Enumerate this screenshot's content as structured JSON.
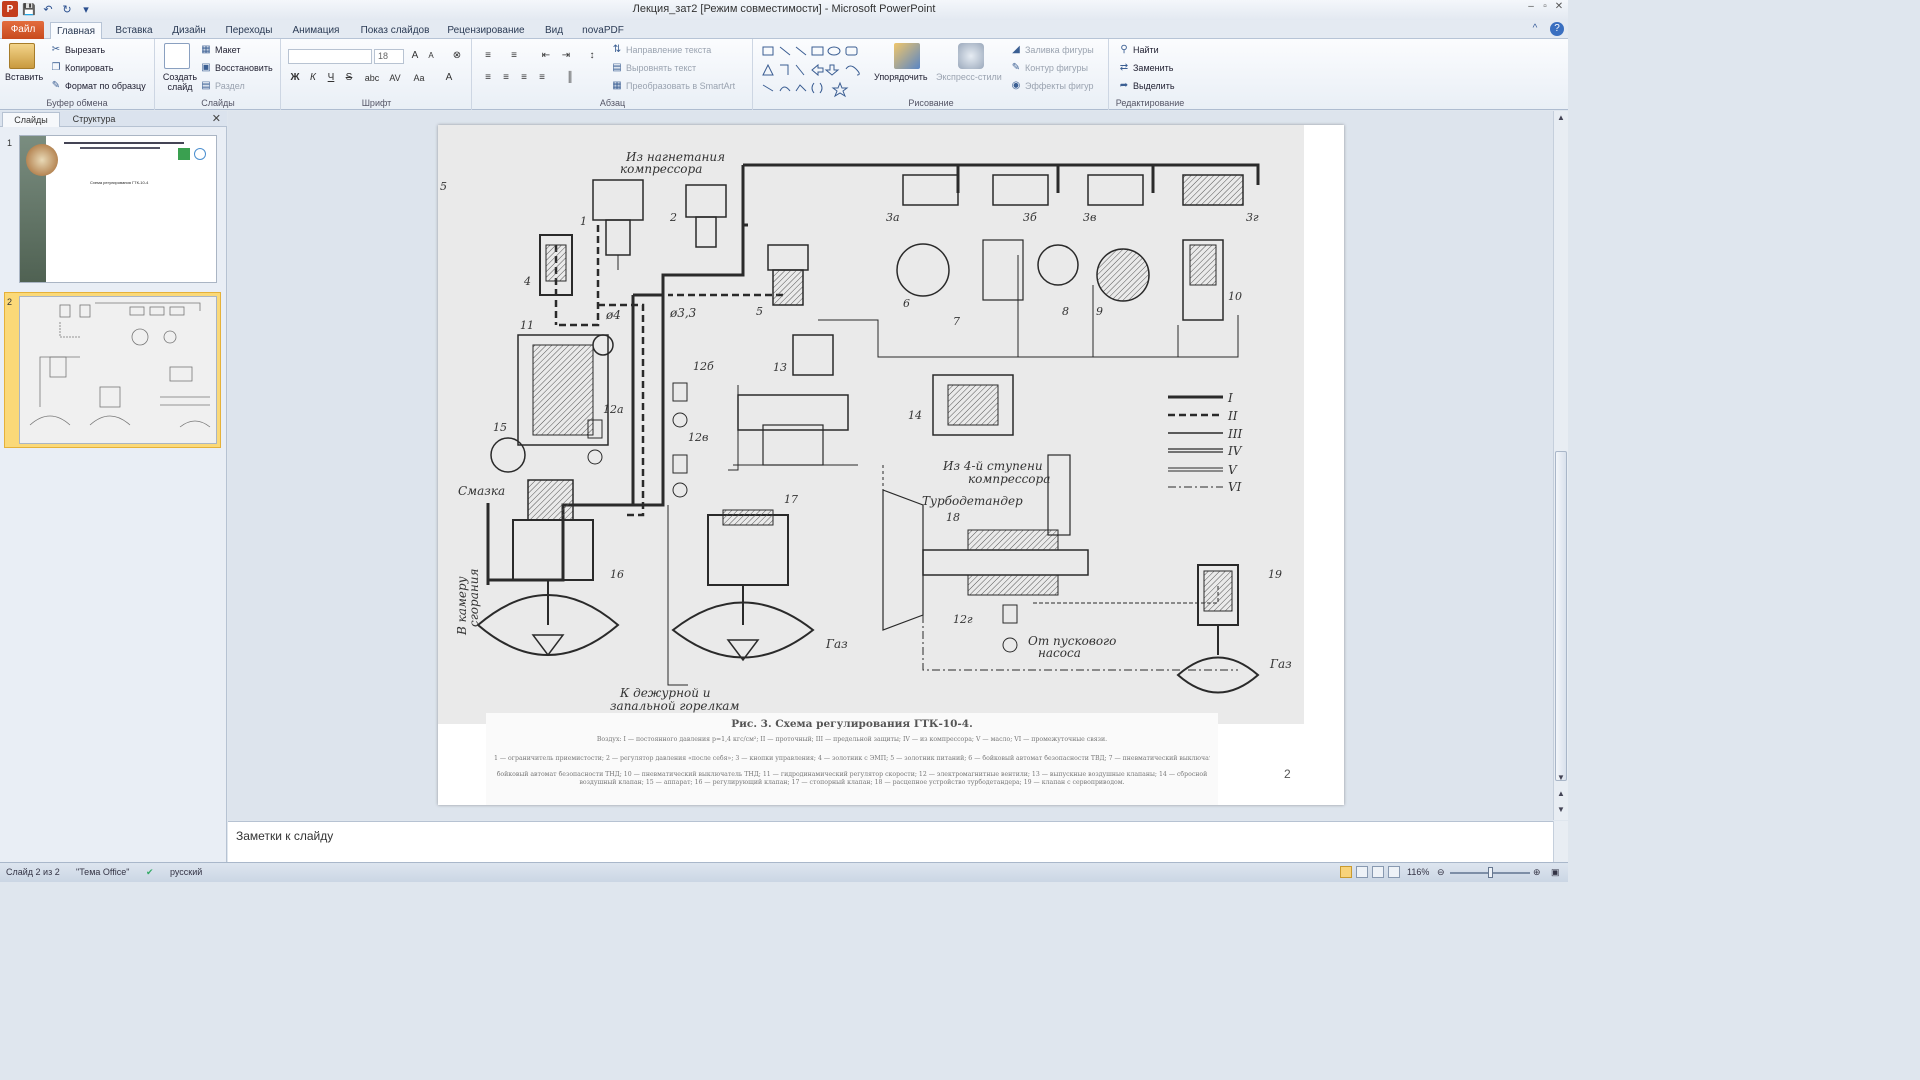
{
  "window": {
    "title": "Лекция_зат2 [Режим совместимости] - Microsoft PowerPoint",
    "app_icon": "P",
    "controls": [
      "–",
      "▫",
      "✕"
    ]
  },
  "quick_access": [
    "save-icon",
    "undo-icon",
    "redo-icon",
    "customize-icon"
  ],
  "ribbon_tabs": {
    "file": "Файл",
    "items": [
      "Главная",
      "Вставка",
      "Дизайн",
      "Переходы",
      "Анимация",
      "Показ слайдов",
      "Рецензирование",
      "Вид",
      "novaPDF"
    ],
    "active_index": 0
  },
  "ribbon": {
    "clipboard": {
      "label": "Буфер обмена",
      "paste": "Вставить",
      "cut": "Вырезать",
      "copy": "Копировать",
      "format_painter": "Формат по образцу"
    },
    "slides": {
      "label": "Слайды",
      "new_slide": "Создать слайд",
      "layout": "Макет",
      "reset": "Восстановить",
      "section": "Раздел"
    },
    "font": {
      "label": "Шрифт",
      "font_name": "",
      "font_size": "18",
      "bold": "Ж",
      "italic": "К",
      "underline": "Ч",
      "strike": "S",
      "shadow": "abc",
      "spacing": "AV",
      "case": "Aa",
      "color": "A"
    },
    "paragraph": {
      "label": "Абзац",
      "text_direction": "Направление текста",
      "align_text": "Выровнять текст",
      "smartart": "Преобразовать в SmartArt"
    },
    "drawing": {
      "label": "Рисование",
      "arrange": "Упорядочить",
      "quick_styles": "Экспресс-стили",
      "shape_fill": "Заливка фигуры",
      "shape_outline": "Контур фигуры",
      "shape_effects": "Эффекты фигур"
    },
    "editing": {
      "label": "Редактирование",
      "find": "Найти",
      "replace": "Заменить",
      "select": "Выделить"
    }
  },
  "left_pane": {
    "tabs": [
      "Слайды",
      "Структура"
    ],
    "close": "✕",
    "slides": [
      {
        "number": "1",
        "title": "Схема регулирования ГТК-10-4"
      },
      {
        "number": "2"
      }
    ]
  },
  "slide": {
    "number": "2",
    "figure": {
      "title": "Рис. 3. Схема регулирования ГТК-10-4.",
      "caption_lines": [
        "Воздух: I — постоянного давления p=1,4 кгс/см²; II — проточный; III — предельной защиты; IV — из компрессора; V — масло; VI — промежуточные связи.",
        "1 — ограничитель приемистости; 2 — регулятор давления «после себя»; 3 — кнопки управления; 4 — золотник с ЭМП; 5 — золотник питаний; 6 — бойковый автомат безопасности ТВД; 7 — пневматический выключатель ТВД; 8 — бойковый автомат безопасности турбодетандера; 9 —",
        "бойковый автомат безопасности ТНД; 10 — пневматический выключатель ТНД; 11 — гидродинамический регулятор скорости; 12 — электромагнитные вентили; 13 — выпускные воздушные клапаны; 14 — сбросной воздушный клапан; 15 — аппарат; 16 — регулирующий клапан; 17 — стопорный клапан; 18 — расцепное устройство турбодетандера; 19 — клапан с сервоприводом."
      ],
      "labels": {
        "compressor_in": "Из нагнетания",
        "compressor_in2": "компрессора",
        "d4": "ø4",
        "d33": "ø3,3",
        "compressor_stage": "Из 4-й ступени",
        "compressor_stage2": "компрессора",
        "turboexpander": "Турбодетандер",
        "oil": "Смазка",
        "to_chamber": "В камеру",
        "to_chamber2": "сгорания",
        "gas": "Газ",
        "gas2": "Газ",
        "pilot": "К дежурной и",
        "pilot2": "запальной горелкам",
        "pump": "От пускового",
        "pump2": "насоса",
        "legend": [
          "I",
          "II",
          "III",
          "IV",
          "V",
          "VI"
        ],
        "n1": "1",
        "n2": "2",
        "n3a": "3а",
        "n3b": "3б",
        "n3v": "3в",
        "n3g": "3г",
        "n4": "4",
        "n5": "5",
        "n6": "6",
        "n7": "7",
        "n8": "8",
        "n9": "9",
        "n10": "10",
        "n11": "11",
        "n12a": "12а",
        "n12b": "12б",
        "n12v": "12в",
        "n12g": "12г",
        "n13": "13",
        "n14": "14",
        "n15": "15",
        "n16": "16",
        "n17": "17",
        "n18": "18",
        "n19": "19",
        "n_edge": "5"
      }
    }
  },
  "notes": {
    "placeholder": "Заметки к слайду"
  },
  "status": {
    "slide": "Слайд 2 из 2",
    "theme": "\"Тема Office\"",
    "language": "русский",
    "zoom": "116%"
  }
}
